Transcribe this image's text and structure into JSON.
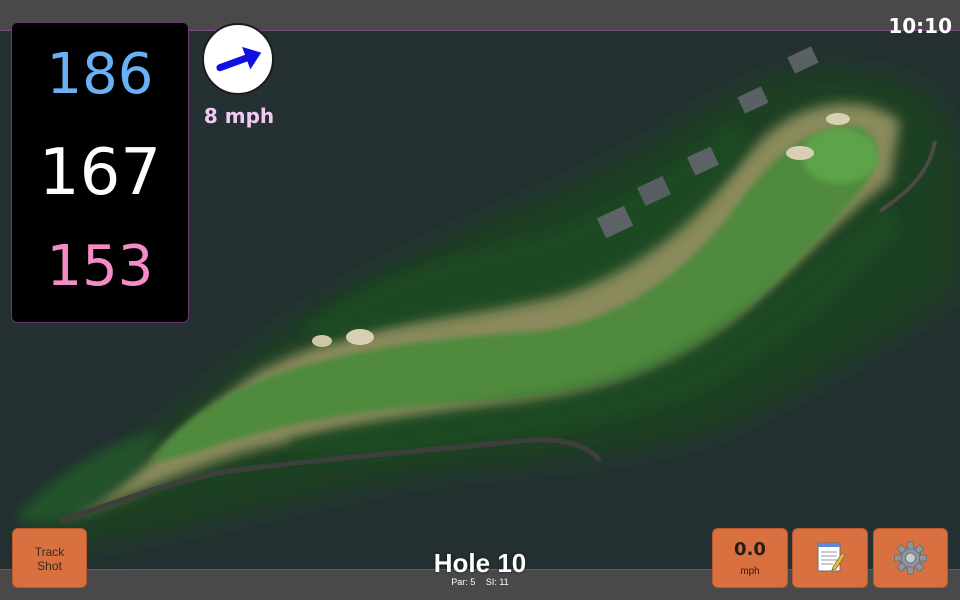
{
  "status_bar": {
    "clock": "10:10"
  },
  "distances": {
    "back": "186",
    "center": "167",
    "front": "153",
    "colors": {
      "back": "#6ab0f5",
      "center": "#ffffff",
      "front": "#f48cc8"
    }
  },
  "wind": {
    "speed_label": "8 mph",
    "icon": "wind-arrow-icon",
    "arrow_color": "#1010e0"
  },
  "hole": {
    "title": "Hole 10",
    "par": "Par: 5",
    "stroke_index": "SI: 11"
  },
  "toolbar": {
    "track_shot_line1": "Track",
    "track_shot_line2": "Shot",
    "speed_value": "0.0",
    "speed_unit": "mph",
    "notes_icon": "notepad-icon",
    "settings_icon": "gear-icon",
    "button_color": "#d9703f"
  },
  "map": {
    "type": "satellite-hole-view",
    "colors": {
      "fairway": "#4f8a3c",
      "trees": "#1f4a22",
      "water": "#243032",
      "rough": "#8c8c5e",
      "sand": "#d8cfb4"
    }
  }
}
